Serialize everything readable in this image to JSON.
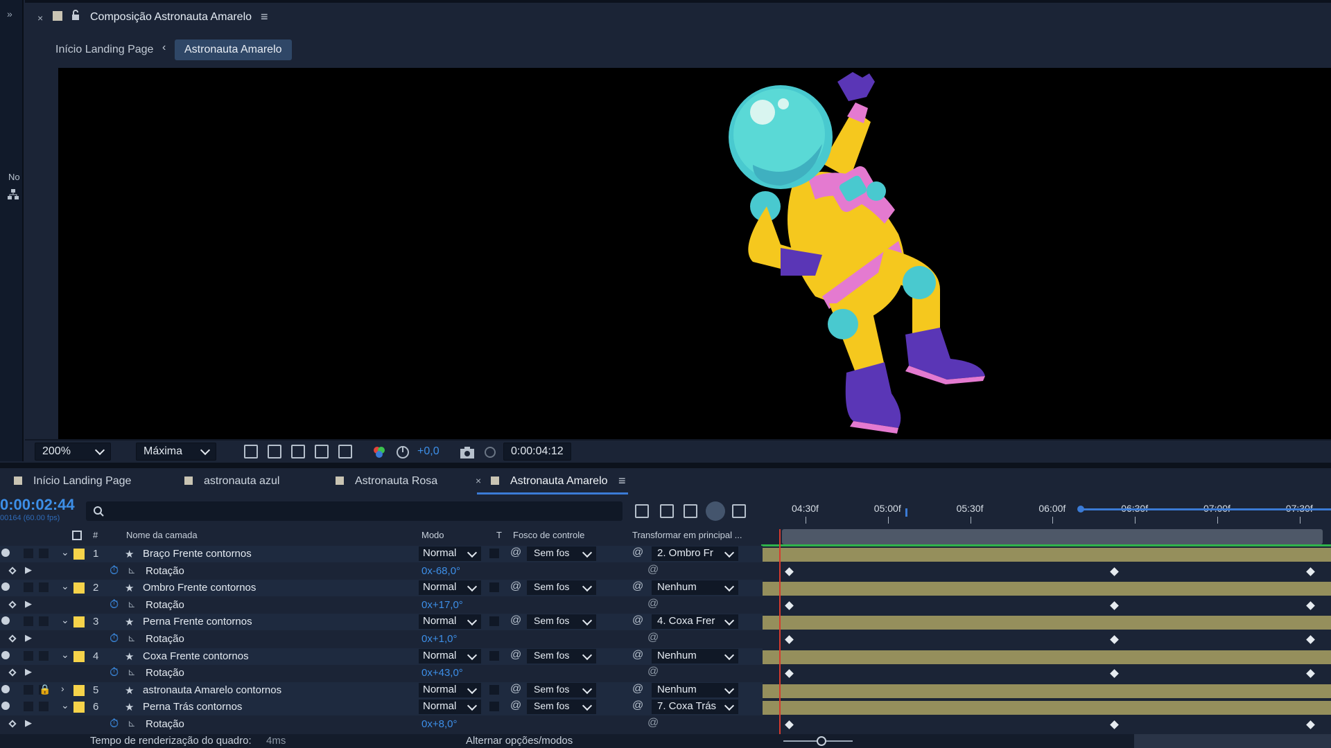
{
  "viewer": {
    "comp_title": "Composição Astronauta Amarelo",
    "breadcrumbs": [
      "Início Landing Page",
      "Astronauta Amarelo"
    ],
    "side_label": "No",
    "zoom": "200%",
    "quality": "Máxima",
    "exposure": "+0,0",
    "timecode": "0:00:04:12"
  },
  "timeline": {
    "tabs": [
      "Início Landing Page",
      "astronauta azul",
      "Astronauta Rosa",
      "Astronauta Amarelo"
    ],
    "current_time": "0:00:02:44",
    "fps_info": "00164 (60.00 fps)",
    "columns": {
      "num": "#",
      "name": "Nome da camada",
      "mode": "Modo",
      "t": "T",
      "track": "Fosco de controle",
      "parent": "Transformar em principal ..."
    },
    "layers": [
      {
        "num": "1",
        "name": "Braço Frente contornos",
        "mode": "Normal",
        "track": "Sem fos",
        "parent": "2. Ombro Fr",
        "prop": "Rotação",
        "value": "0x-68,0°"
      },
      {
        "num": "2",
        "name": "Ombro Frente contornos",
        "mode": "Normal",
        "track": "Sem fos",
        "parent": "Nenhum",
        "prop": "Rotação",
        "value": "0x+17,0°"
      },
      {
        "num": "3",
        "name": "Perna Frente contornos",
        "mode": "Normal",
        "track": "Sem fos",
        "parent": "4. Coxa Frer",
        "prop": "Rotação",
        "value": "0x+1,0°"
      },
      {
        "num": "4",
        "name": "Coxa Frente contornos",
        "mode": "Normal",
        "track": "Sem fos",
        "parent": "Nenhum",
        "prop": "Rotação",
        "value": "0x+43,0°"
      },
      {
        "num": "5",
        "name": "astronauta Amarelo contornos",
        "mode": "Normal",
        "track": "Sem fos",
        "parent": "Nenhum"
      },
      {
        "num": "6",
        "name": "Perna Trás contornos",
        "mode": "Normal",
        "track": "Sem fos",
        "parent": "7. Coxa Trás",
        "prop": "Rotação",
        "value": "0x+8,0°"
      }
    ],
    "ruler": [
      "04:30f",
      "05:00f",
      "05:30f",
      "06:00f",
      "06:30f",
      "07:00f",
      "07:30f"
    ],
    "status_label": "Tempo de renderização do quadro:",
    "status_value": "4ms",
    "toggle_label": "Alternar opções/modos"
  },
  "colors": {
    "accent": "#3d8fe8",
    "layer_label": "#f6d34a",
    "bar": "#958f5c",
    "playhead": "#d63a2e"
  }
}
